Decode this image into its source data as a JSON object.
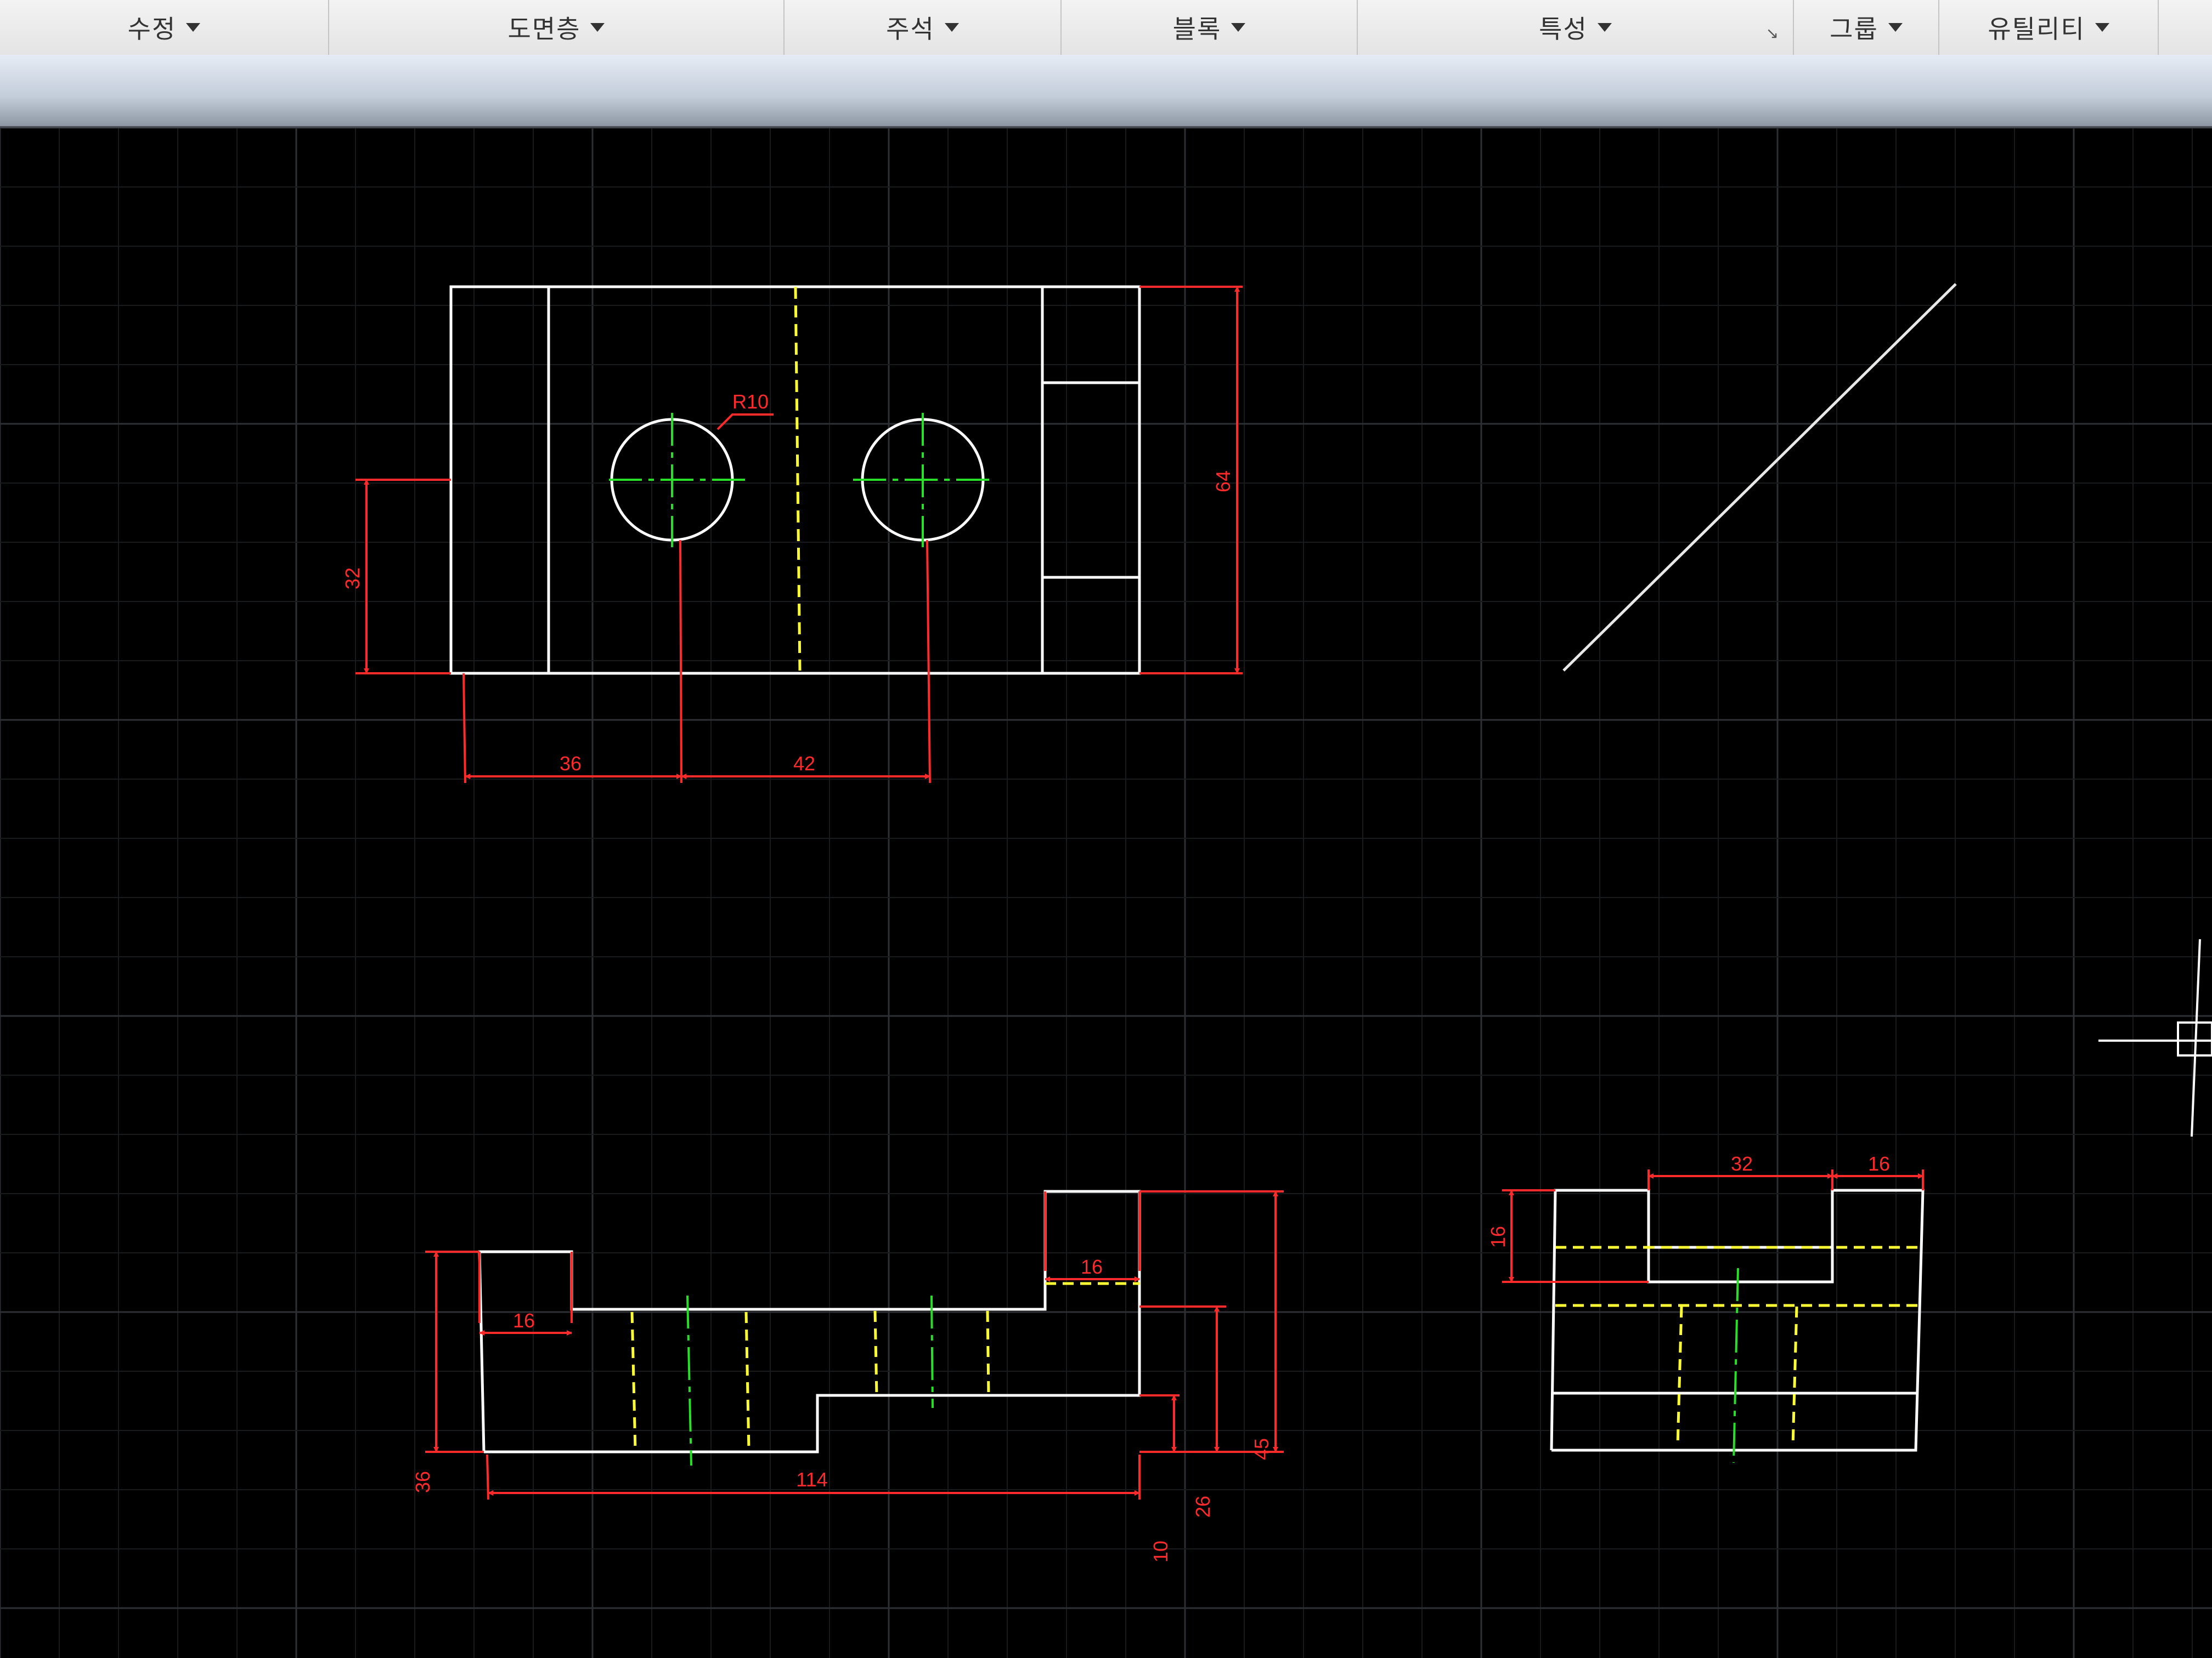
{
  "ribbon": {
    "panels": [
      {
        "label": "수정"
      },
      {
        "label": "도면층"
      },
      {
        "label": "주석"
      },
      {
        "label": "블록"
      },
      {
        "label": "특성"
      },
      {
        "label": "그룹"
      },
      {
        "label": "유틸리티"
      }
    ],
    "properties_launcher": "↘"
  },
  "drawing": {
    "colors": {
      "object": "#ffffff",
      "dimension": "#ff2a2a",
      "center": "#27e027",
      "hidden": "#ffff33"
    },
    "dimensions": {
      "top_view": {
        "radius": "R10",
        "height_total": "64",
        "hole_height": "32",
        "hole1_x": "36",
        "hole_spacing": "42"
      },
      "front_view": {
        "left_step": "16",
        "right_step": "16",
        "left_height": "36",
        "right_height": "45",
        "mid_height": "26",
        "bottom_height": "10",
        "length": "114"
      },
      "side_view": {
        "slot_width": "32",
        "wall": "16",
        "slot_depth": "16"
      }
    }
  }
}
